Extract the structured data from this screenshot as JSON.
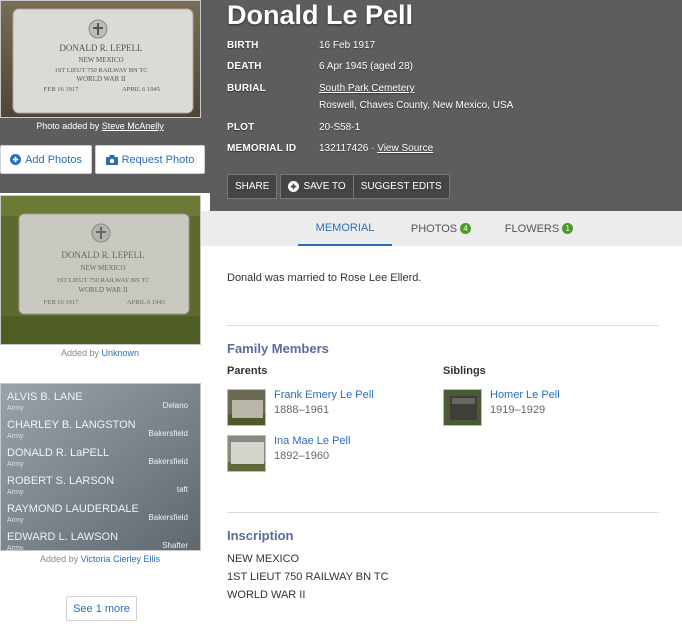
{
  "memorial": {
    "name": "Donald Le Pell",
    "birth_label": "BIRTH",
    "birth_value": "16 Feb 1917",
    "death_label": "DEATH",
    "death_value": "6 Apr 1945 (aged 28)",
    "burial_label": "BURIAL",
    "burial_cemetery": "South Park Cemetery",
    "burial_location": "Roswell, Chaves County, New Mexico, USA",
    "plot_label": "PLOT",
    "plot_value": "20-S58-1",
    "memorial_id_label": "MEMORIAL ID",
    "memorial_id_value": "132117426 ·",
    "view_source": "View Source"
  },
  "actions": {
    "share": "SHARE",
    "save_to": "SAVE TO",
    "suggest_edits": "SUGGEST EDITS"
  },
  "tabs": [
    {
      "label": "MEMORIAL",
      "count": ""
    },
    {
      "label": "PHOTOS",
      "count": "4"
    },
    {
      "label": "FLOWERS",
      "count": "1"
    }
  ],
  "photos": {
    "main_caption_prefix": "Photo added by",
    "main_caption_user": "Steve McAnelly",
    "add_photos": "Add Photos",
    "request_photo": "Request Photo",
    "photo2_caption_prefix": "Added by",
    "photo2_caption_user": "Unknown",
    "photo3_caption_prefix": "Added by",
    "photo3_caption_user": "Victoria Cierley Ellis",
    "see_more": "See 1 more",
    "headstone_text": [
      "DONALD R. LEPELL",
      "NEW MEXICO",
      "1ST LIEUT 750 RAILWAY BN TC",
      "WORLD WAR II",
      "FEB 16 1917",
      "APRIL 6 1945"
    ],
    "memorial_wall": [
      {
        "name": "ALVIS B. LANE",
        "place": "Delano"
      },
      {
        "name": "CHARLEY B. LANGSTON",
        "place": "Bakersfield"
      },
      {
        "name": "DONALD R. LaPELL",
        "place": "Bakersfield"
      },
      {
        "name": "ROBERT S. LARSON",
        "place": "taft"
      },
      {
        "name": "RAYMOND LAUDERDALE",
        "place": "Bakersfield"
      },
      {
        "name": "EDWARD L. LAWSON",
        "place": "Shafter"
      }
    ],
    "memorial_wall_rank": "Army"
  },
  "bio": "Donald was married to Rose Lee Ellerd.",
  "family": {
    "title": "Family Members",
    "parents_label": "Parents",
    "siblings_label": "Siblings",
    "parents": [
      {
        "name": "Frank Emery Le Pell",
        "dates": "1888–1961"
      },
      {
        "name": "Ina Mae Le Pell",
        "dates": "1892–1960"
      }
    ],
    "siblings": [
      {
        "name": "Homer Le Pell",
        "dates": "1919–1929"
      }
    ]
  },
  "inscription": {
    "title": "Inscription",
    "lines": [
      "NEW MEXICO",
      "1ST LIEUT 750 RAILWAY BN TC",
      "WORLD WAR II"
    ]
  },
  "colors": {
    "header_bg": "#5d5d5d",
    "link": "#2a6ebb",
    "section_title": "#5a6c9a",
    "badge": "#4a9a2a"
  }
}
